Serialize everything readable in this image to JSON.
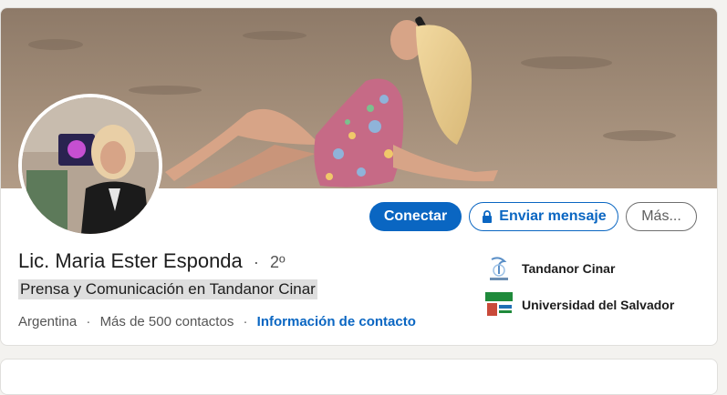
{
  "profile": {
    "name": "Lic. Maria Ester Esponda",
    "separator": "·",
    "degree": "2º",
    "headline": "Prensa y Comunicación en Tandanor Cinar",
    "location": "Argentina",
    "connections": "Más de 500 contactos",
    "contact_info": "Información de contacto"
  },
  "actions": {
    "connect": "Conectar",
    "message": "Enviar mensaje",
    "more": "Más..."
  },
  "organizations": [
    {
      "name": "Tandanor Cinar",
      "icon": "tandanor-logo"
    },
    {
      "name": "Universidad del Salvador",
      "icon": "usal-logo"
    }
  ],
  "colors": {
    "accent": "#0a66c2",
    "background": "#f3f2ef",
    "card": "#ffffff"
  }
}
